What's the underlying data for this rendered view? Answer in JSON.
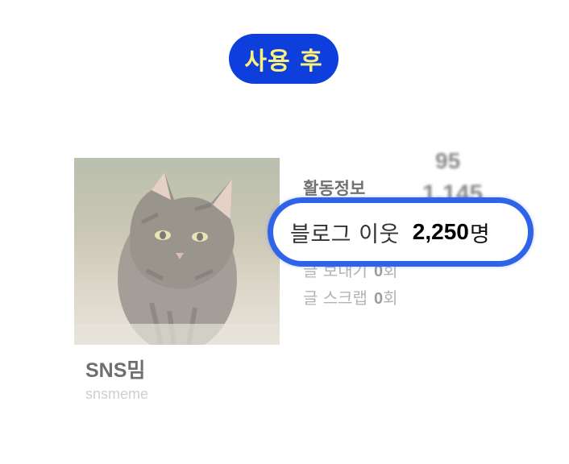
{
  "badge": {
    "label": "사용 후"
  },
  "profile": {
    "name": "SNS밈",
    "id": "snsmeme",
    "photo_icon": "kitten-photo"
  },
  "activity": {
    "title": "활동정보",
    "blurred_values": [
      "95",
      "1,145"
    ],
    "highlighted": {
      "label": "블로그 이웃",
      "count": "2,250",
      "unit": "명"
    },
    "rows": [
      {
        "label": "글 보내기",
        "count": "0",
        "unit": "회"
      },
      {
        "label": "글 스크랩",
        "count": "0",
        "unit": "회"
      }
    ]
  },
  "colors": {
    "badge_bg": "#0e3fdc",
    "badge_text": "#fbf07a",
    "highlight_border": "#2f63ea"
  }
}
